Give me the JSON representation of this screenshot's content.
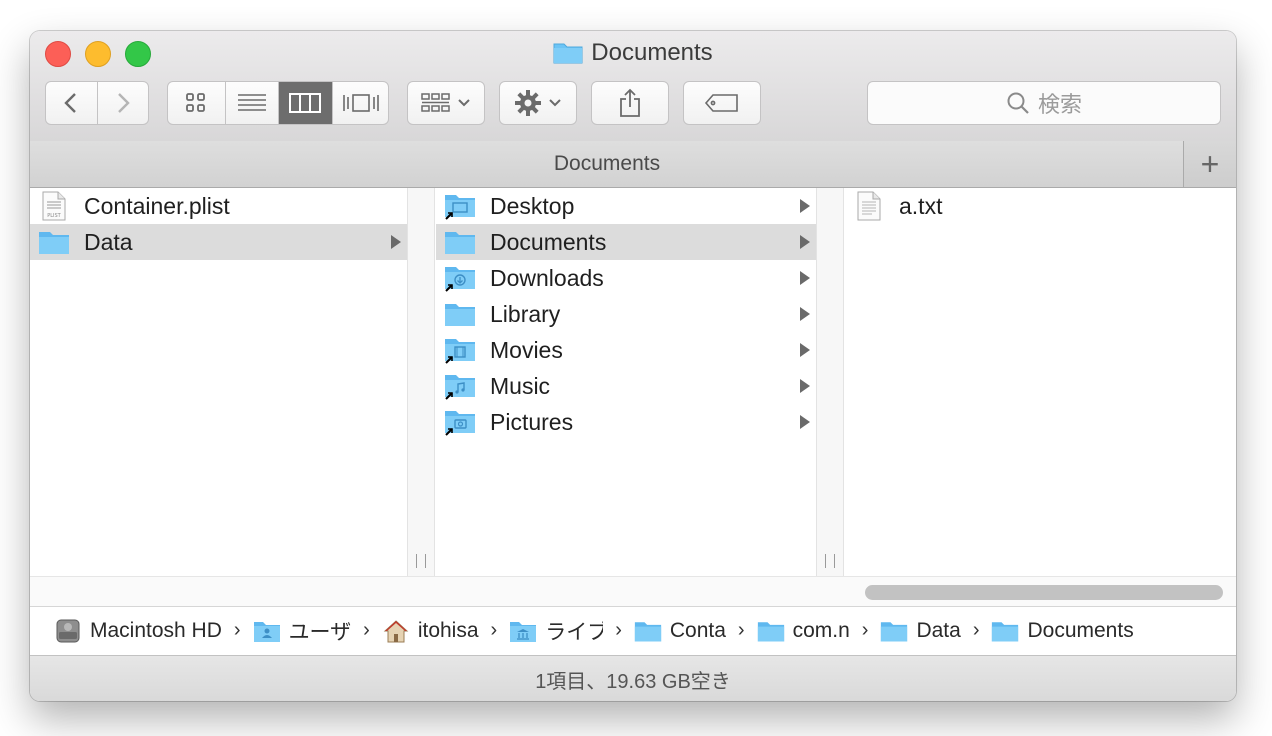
{
  "window": {
    "title": "Documents"
  },
  "toolbar": {
    "back": "back-button",
    "forward": "forward-button",
    "views": [
      "icon-view",
      "list-view",
      "column-view",
      "cover-flow-view"
    ],
    "active_view": "column-view",
    "search_placeholder": "検索"
  },
  "pathbar": {
    "title": "Documents",
    "add_label": "+"
  },
  "columns": {
    "col1": [
      {
        "name": "Container.plist",
        "icon": "plist-file-icon",
        "selected": false,
        "arrow": false
      },
      {
        "name": "Data",
        "icon": "folder-icon",
        "selected": true,
        "arrow": true
      }
    ],
    "col2": [
      {
        "name": "Desktop",
        "icon": "desktop-folder-icon",
        "selected": false,
        "arrow": true
      },
      {
        "name": "Documents",
        "icon": "folder-icon",
        "selected": true,
        "arrow": true
      },
      {
        "name": "Downloads",
        "icon": "downloads-folder-icon",
        "selected": false,
        "arrow": true
      },
      {
        "name": "Library",
        "icon": "folder-icon",
        "selected": false,
        "arrow": true
      },
      {
        "name": "Movies",
        "icon": "movies-folder-icon",
        "selected": false,
        "arrow": true
      },
      {
        "name": "Music",
        "icon": "music-folder-icon",
        "selected": false,
        "arrow": true
      },
      {
        "name": "Pictures",
        "icon": "pictures-folder-icon",
        "selected": false,
        "arrow": true
      }
    ],
    "col3": [
      {
        "name": "a.txt",
        "icon": "text-file-icon",
        "selected": false,
        "arrow": false
      }
    ]
  },
  "breadcrumb": [
    {
      "label": "Macintosh HD",
      "icon": "hard-drive-icon"
    },
    {
      "label": "ユーザ",
      "icon": "users-folder-icon"
    },
    {
      "label": "itohisa",
      "icon": "home-icon"
    },
    {
      "label": "ライブ",
      "icon": "library-folder-icon"
    },
    {
      "label": "Conta",
      "icon": "folder-icon"
    },
    {
      "label": "com.n",
      "icon": "folder-icon"
    },
    {
      "label": "Data",
      "icon": "folder-icon"
    },
    {
      "label": "Documents",
      "icon": "folder-icon"
    }
  ],
  "status": {
    "text": "1項目、19.63 GB空き"
  },
  "colors": {
    "folder": "#6cc4f5",
    "selection": "#dcdcdc",
    "active_view": "#6d6d6d"
  }
}
